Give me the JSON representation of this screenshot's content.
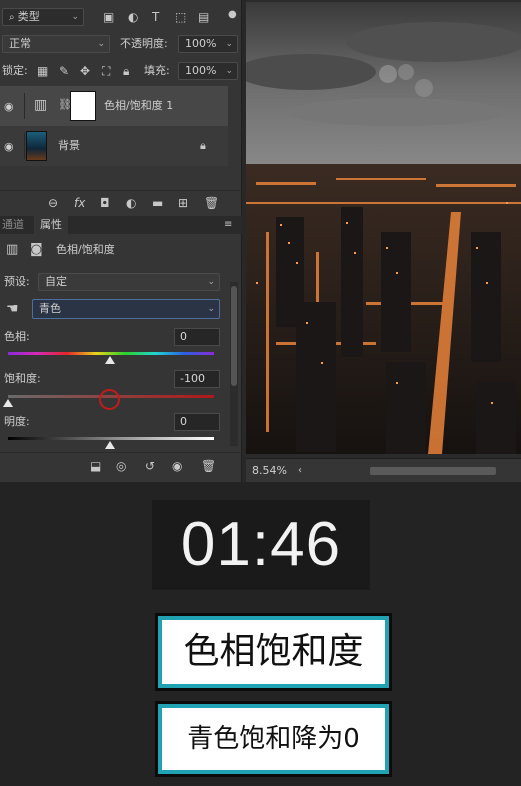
{
  "layers_panel": {
    "filter_label": "类型",
    "blend_mode": "正常",
    "opacity_label": "不透明度:",
    "opacity_value": "100%",
    "lock_label": "锁定:",
    "fill_label": "填充:",
    "fill_value": "100%",
    "layers": [
      {
        "name": "色相/饱和度 1"
      },
      {
        "name": "背景"
      }
    ]
  },
  "properties_panel": {
    "tabs": [
      "通道",
      "属性"
    ],
    "adjustment_title": "色相/饱和度",
    "preset_label": "预设:",
    "preset_value": "自定",
    "channel_value": "青色",
    "hue_label": "色相:",
    "hue_value": "0",
    "saturation_label": "饱和度:",
    "saturation_value": "-100",
    "lightness_label": "明度:",
    "lightness_value": "0"
  },
  "canvas": {
    "zoom": "8.54%"
  },
  "overlay": {
    "timer": "01:46",
    "caption_1": "色相饱和度",
    "caption_2": "青色饱和降为0"
  },
  "colors": {
    "caption_border": "#20a2b3",
    "saturation_slider": "#b01818"
  }
}
